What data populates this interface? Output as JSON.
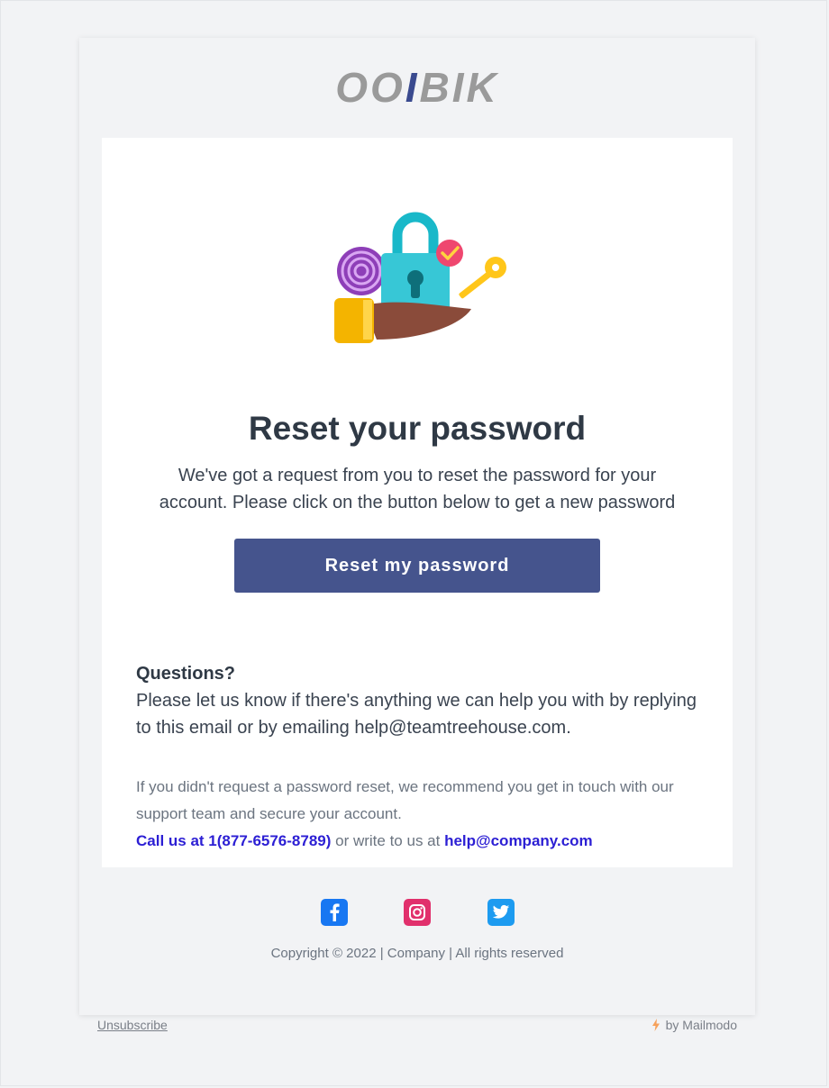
{
  "brand": {
    "logo_part1": "OO",
    "logo_accent": "I",
    "logo_part2": "BIK",
    "accent_color": "#3a4a8f"
  },
  "hero": {
    "icon": "password-security-illustration"
  },
  "main": {
    "title": "Reset your password",
    "intro": "We've got a request from you to reset the password for your account. Please click on the button below to get a new password",
    "button_label": "Reset my password",
    "button_color": "#45548d"
  },
  "questions": {
    "heading": "Questions?",
    "body": "Please let us know if there's anything we can help you with by replying to this email or by emailing help@teamtreehouse.com."
  },
  "notice": {
    "text": "If you didn't request a password reset, we recommend you get in touch with our support team and secure your account.",
    "call_label": "Call us at 1(877-6576-8789)",
    "middle_text": " or write to us at ",
    "email_label": "help@company.com",
    "link_color": "#2c1fd4"
  },
  "footer": {
    "socials": [
      {
        "icon": "facebook-icon"
      },
      {
        "icon": "instagram-icon"
      },
      {
        "icon": "twitter-icon"
      }
    ],
    "copyright": "Copyright © 2022 | Company | All rights reserved",
    "unsubscribe": "Unsubscribe",
    "powered_by": "by Mailmodo"
  }
}
